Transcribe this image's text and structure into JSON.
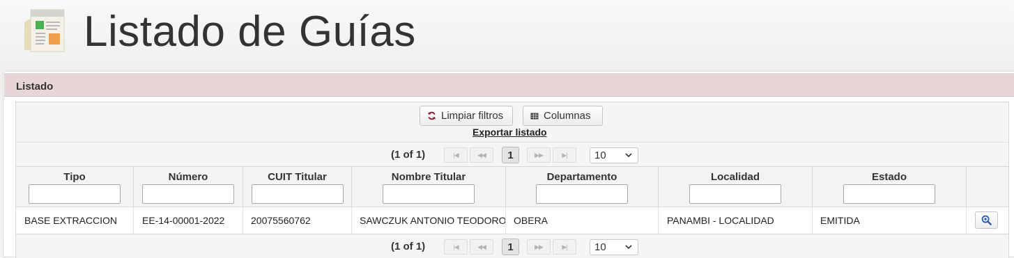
{
  "page": {
    "title": "Listado de Guías"
  },
  "panel": {
    "title": "Listado"
  },
  "toolbar": {
    "clear_filters_label": "Limpiar filtros",
    "columns_label": "Columnas",
    "export_label": "Exportar listado"
  },
  "paginator": {
    "status": "(1 of 1)",
    "current_page": "1",
    "rows_per_page": "10",
    "nav_first": "|◀",
    "nav_prev": "◀◀",
    "nav_next": "▶▶",
    "nav_last": "▶|"
  },
  "table": {
    "columns": [
      {
        "label": "Tipo",
        "filter": ""
      },
      {
        "label": "Número",
        "filter": ""
      },
      {
        "label": "CUIT Titular",
        "filter": ""
      },
      {
        "label": "Nombre Titular",
        "filter": ""
      },
      {
        "label": "Departamento",
        "filter": ""
      },
      {
        "label": "Localidad",
        "filter": ""
      },
      {
        "label": "Estado",
        "filter": ""
      }
    ],
    "rows": [
      {
        "tipo": "BASE EXTRACCION",
        "numero": "EE-14-00001-2022",
        "cuit": "20075560762",
        "nombre": "SAWCZUK ANTONIO TEODORO",
        "departamento": "OBERA",
        "localidad": "PANAMBI - LOCALIDAD",
        "estado": "EMITIDA"
      }
    ]
  },
  "icons": {
    "page": "newspaper-icon",
    "clear_filters": "refresh-icon",
    "columns": "table-icon",
    "view": "zoom-in-icon"
  },
  "colors": {
    "panel_header": "#e8d5d6",
    "refresh_icon": "#8b1a2b",
    "view_icon": "#2a5fb0"
  }
}
